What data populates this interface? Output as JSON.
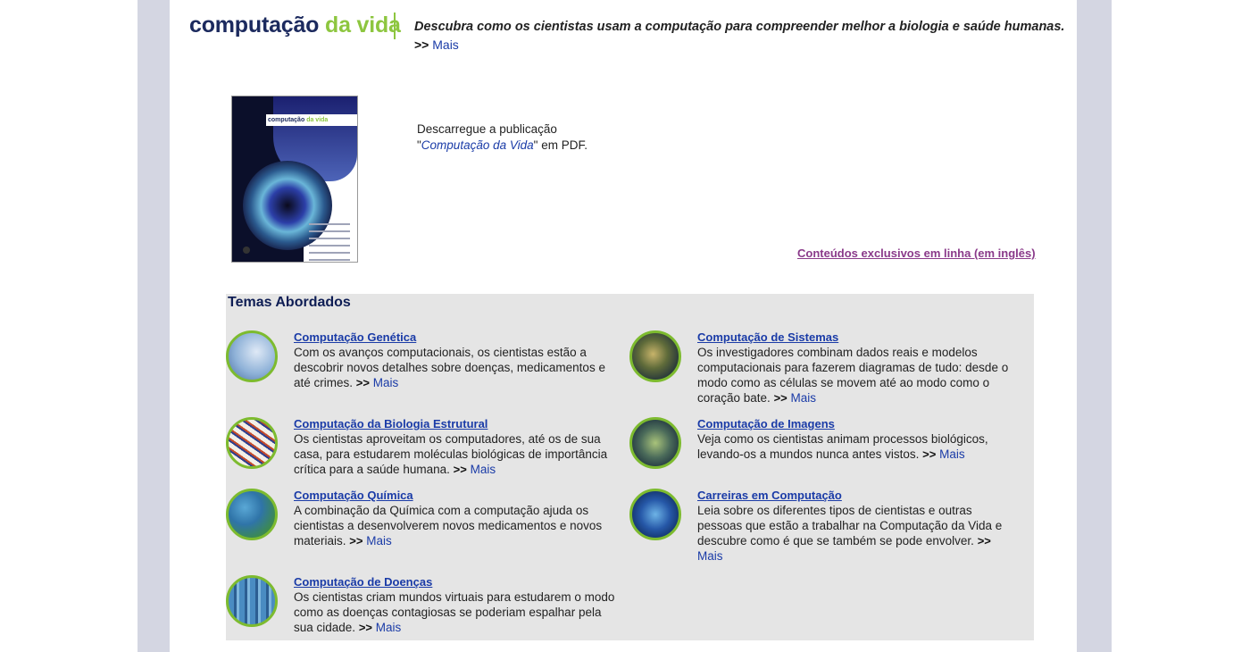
{
  "header": {
    "logo_word1": "computação",
    "logo_word2": "da vida",
    "tagline": "Descubra como os cientistas usam a computação para compreender melhor a biologia e saúde humanas.",
    "arrows": ">>",
    "more_label": "Mais"
  },
  "cover": {
    "title_part1": "computação",
    "title_part2": "da vida"
  },
  "download": {
    "line1": "Descarregue a publicação",
    "quote_open": "\"",
    "title": "Computação da Vida",
    "quote_close": "\"",
    "suffix": " em PDF."
  },
  "exclusive_link": "Conteúdos exclusivos em linha (em inglês)",
  "topics": {
    "heading": "Temas Abordados",
    "items": [
      {
        "title": "Computação Genética",
        "desc": "Com os avanços computacionais, os cientistas estão a descobrir novos detalhes sobre doenças, medicamentos e até crimes.",
        "arrows": ">>",
        "more": "Mais"
      },
      {
        "title": "Computação de Sistemas",
        "desc": "Os investigadores combinam dados reais e modelos computacionais para fazerem diagramas de tudo: desde o modo como as células se movem até ao modo como o coração bate.",
        "arrows": ">>",
        "more": "Mais"
      },
      {
        "title": "Computação da Biologia Estrutural",
        "desc": "Os cientistas aproveitam os computadores, até os de sua casa, para estudarem moléculas biológicas de importância crítica para a saúde humana.",
        "arrows": ">>",
        "more": "Mais"
      },
      {
        "title": "Computação de Imagens",
        "desc": "Veja como os cientistas animam processos biológicos, levando-os a mundos nunca antes vistos.",
        "arrows": ">>",
        "more": "Mais"
      },
      {
        "title": "Computação Química",
        "desc": "A combinação da Química com a computação ajuda os cientistas a desenvolverem novos medicamentos e novos materiais.",
        "arrows": ">>",
        "more": "Mais"
      },
      {
        "title": "Carreiras em Computação",
        "desc": "Leia sobre os diferentes tipos de cientistas e outras pessoas que estão a trabalhar na Computação da Vida e descubre como é que se também se pode envolver.",
        "arrows": ">>",
        "more": "Mais"
      },
      {
        "title": "Computação de Doenças",
        "desc": "Os cientistas criam mundos virtuais para estudarem o modo como as doenças contagiosas se poderiam espalhar pela sua cidade.",
        "arrows": ">>",
        "more": "Mais"
      }
    ]
  },
  "colors": {
    "side_band": "#d4d6e2",
    "logo_navy": "#1c2a5e",
    "logo_green": "#8dc63f",
    "link_blue": "#1a3ba7",
    "exclusive_purple": "#8a3a8a",
    "topics_bg": "#e5e5e5",
    "thumb_ring": "#7dbb2f"
  }
}
